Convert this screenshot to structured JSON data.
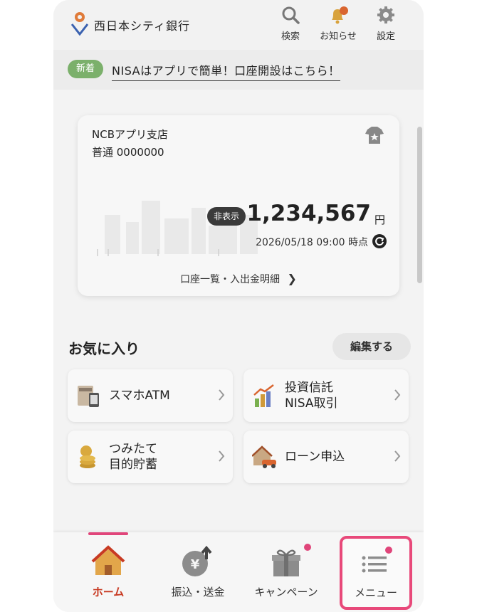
{
  "header": {
    "bank_name": "西日本シティ銀行",
    "search_label": "検索",
    "notice_label": "お知らせ",
    "settings_label": "設定"
  },
  "news": {
    "badge": "新着",
    "text": "NISAはアプリで簡単！口座開設はこちら！"
  },
  "account_card": {
    "branch": "NCBアプリ支店",
    "account": "普通 0000000",
    "hide_label": "非表示",
    "balance": "1,234,567",
    "currency": "円",
    "as_of": "2026/05/18 09:00 時点",
    "link": "口座一覧・入出金明細"
  },
  "favorites": {
    "title": "お気に入り",
    "edit_label": "編集する",
    "items": [
      {
        "label": "スマホATM",
        "icon": "smartphone-atm-icon"
      },
      {
        "label": "投資信託\nNISA取引",
        "icon": "investment-chart-icon"
      },
      {
        "label": "つみたて\n目的貯蓄",
        "icon": "coin-stack-icon"
      },
      {
        "label": "ローン申込",
        "icon": "house-car-icon"
      }
    ]
  },
  "bottom_nav": {
    "items": [
      {
        "label": "ホーム",
        "icon": "home-icon",
        "active": true
      },
      {
        "label": "振込・送金",
        "icon": "yen-transfer-icon"
      },
      {
        "label": "キャンペーン",
        "icon": "gift-icon"
      },
      {
        "label": "メニュー",
        "icon": "menu-list-icon"
      }
    ]
  },
  "colors": {
    "accent_pink": "#e8497a",
    "active_home": "#c83a22",
    "badge_green": "#7bb06b"
  }
}
